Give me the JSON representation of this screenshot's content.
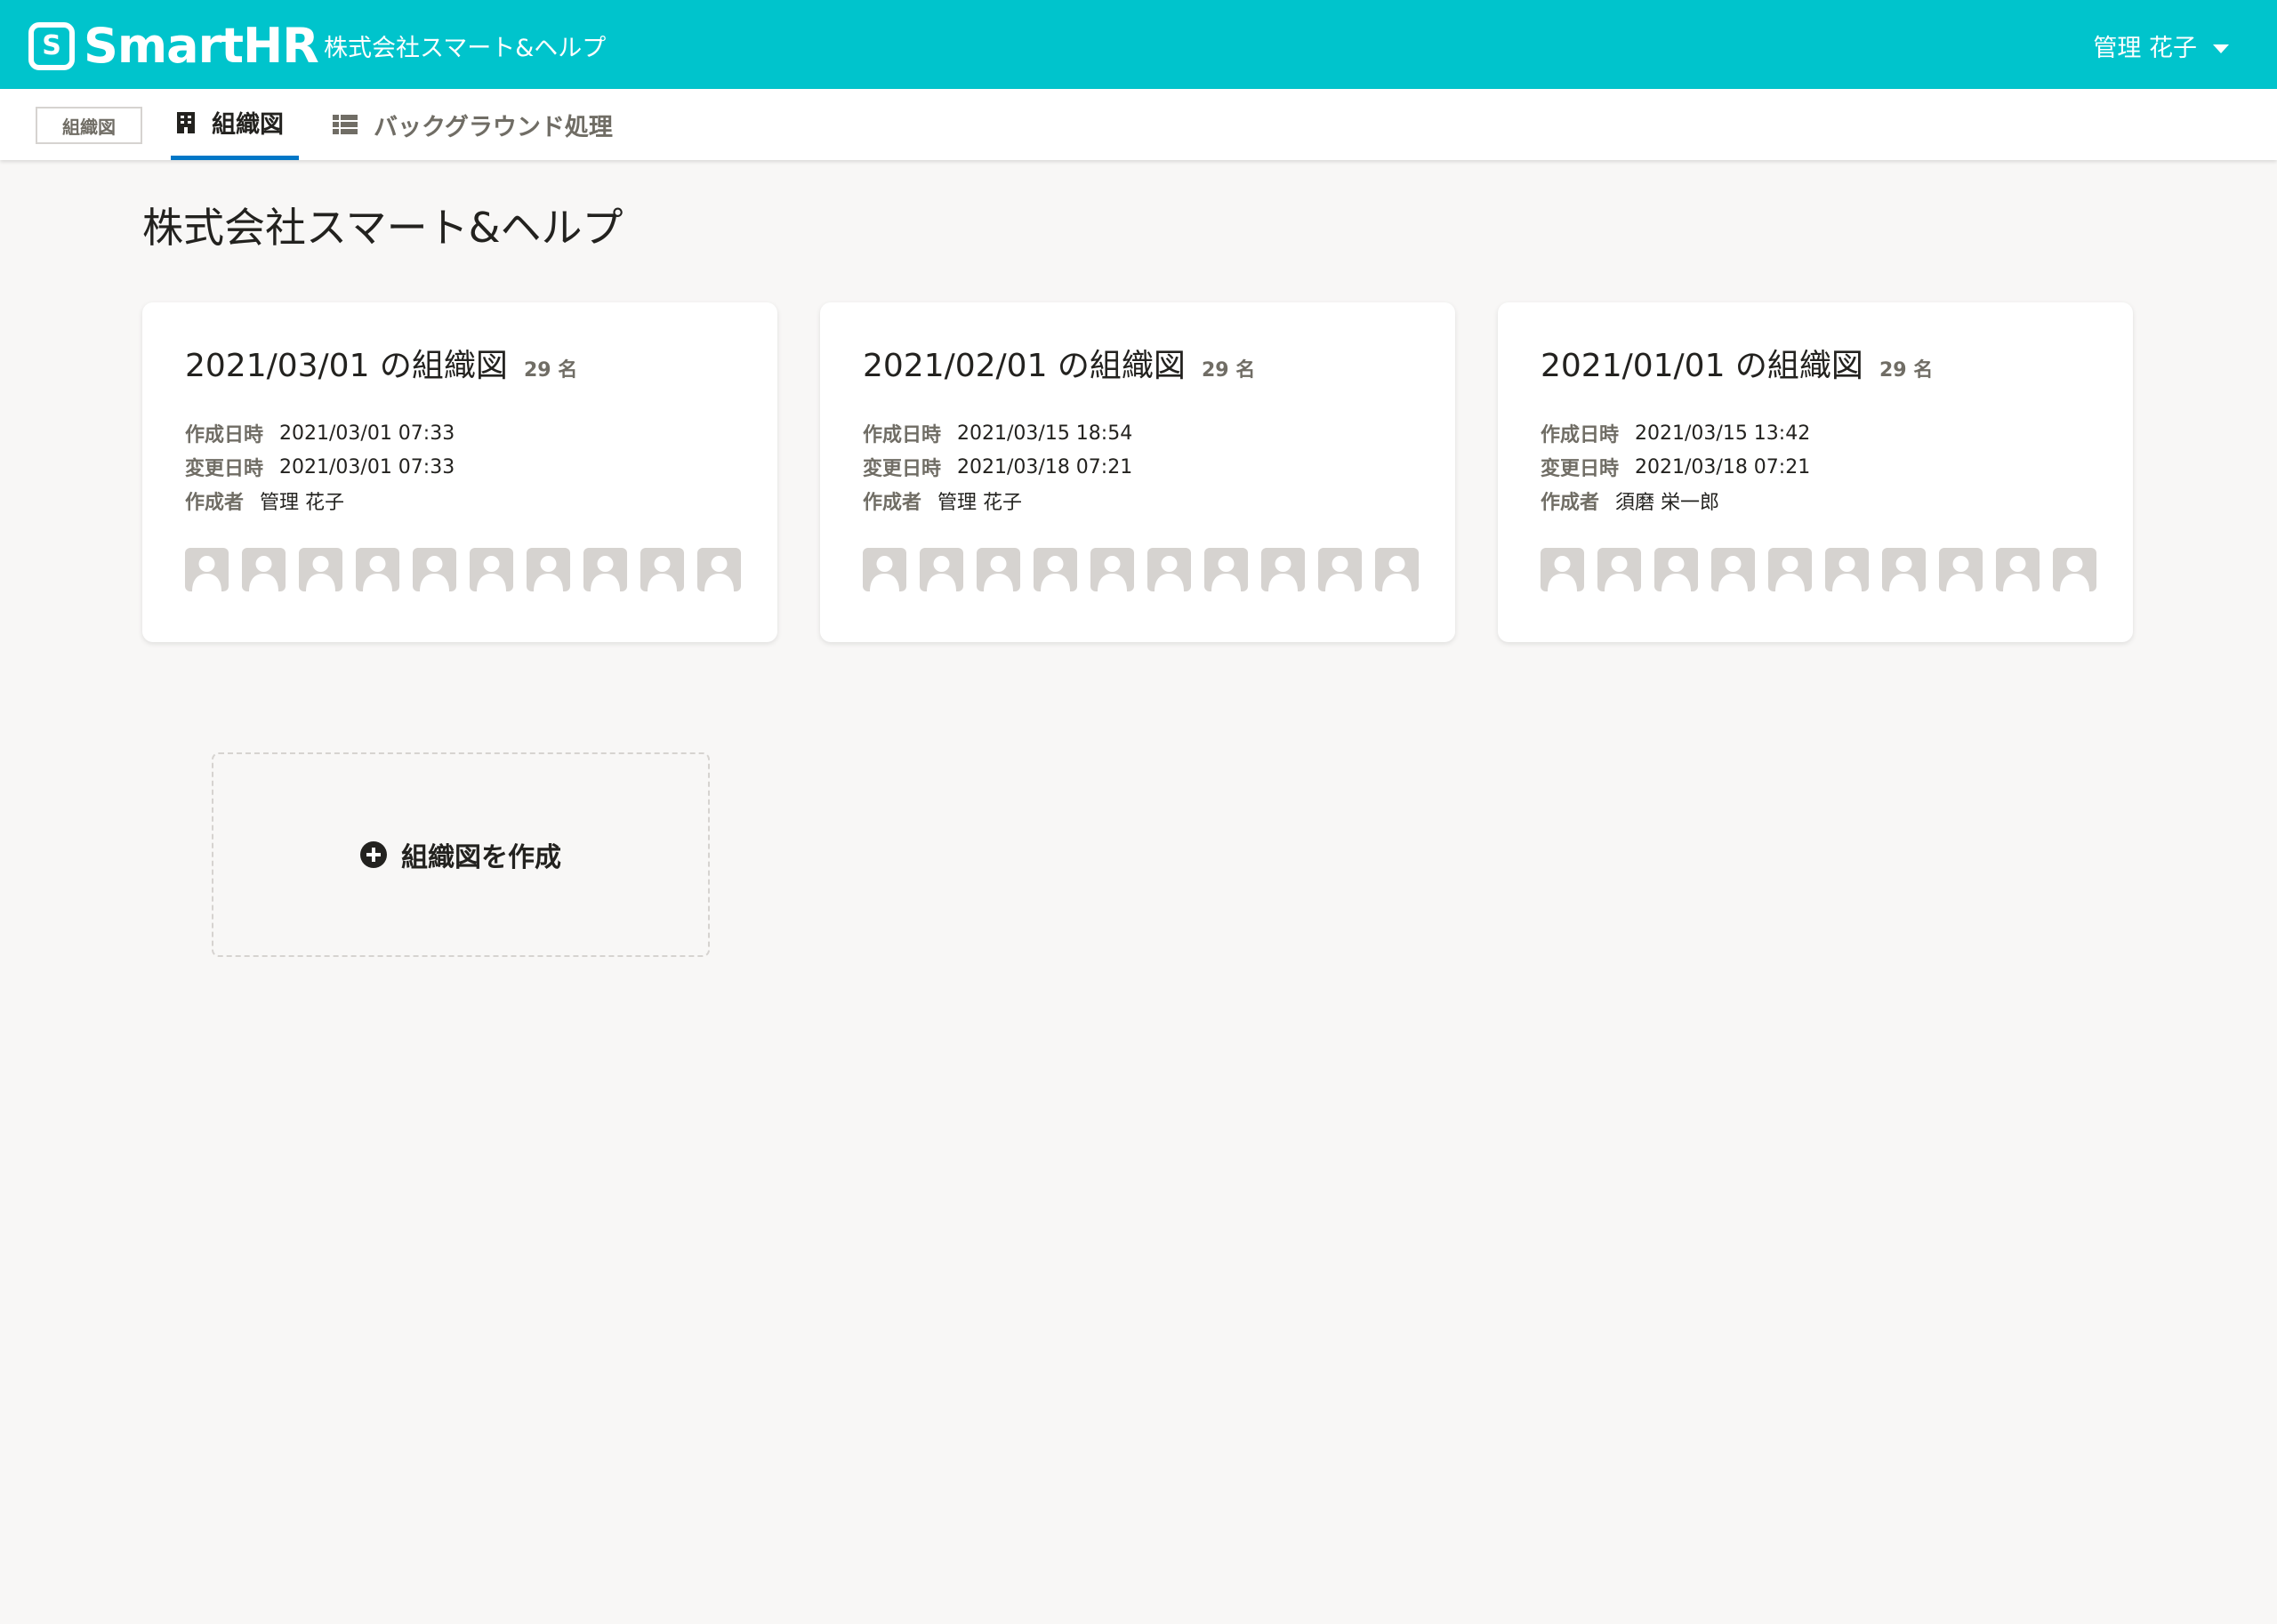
{
  "header": {
    "logo_mark": "S",
    "logo_text": "SmartHR",
    "company": "株式会社スマート&ヘルプ",
    "user": "管理 花子",
    "brand_color": "#00c4cc"
  },
  "subnav": {
    "app_badge": "組織図",
    "tabs": [
      {
        "label": "組織図",
        "icon": "building-icon",
        "active": true
      },
      {
        "label": "バックグラウンド処理",
        "icon": "list-icon",
        "active": false
      }
    ],
    "accent_color": "#0077c7"
  },
  "main": {
    "title": "株式会社スマート&ヘルプ",
    "cards": [
      {
        "title": "2021/03/01 の組織図",
        "count": "29 名",
        "created_label": "作成日時",
        "created": "2021/03/01 07:33",
        "updated_label": "変更日時",
        "updated": "2021/03/01 07:33",
        "author_label": "作成者",
        "author": "管理 花子"
      },
      {
        "title": "2021/02/01 の組織図",
        "count": "29 名",
        "created_label": "作成日時",
        "created": "2021/03/15 18:54",
        "updated_label": "変更日時",
        "updated": "2021/03/18 07:21",
        "author_label": "作成者",
        "author": "管理 花子"
      },
      {
        "title": "2021/01/01 の組織図",
        "count": "29 名",
        "created_label": "作成日時",
        "created": "2021/03/15 13:42",
        "updated_label": "変更日時",
        "updated": "2021/03/18 07:21",
        "author_label": "作成者",
        "author": "須磨 栄一郎"
      }
    ],
    "create_label": "組織図を作成"
  }
}
